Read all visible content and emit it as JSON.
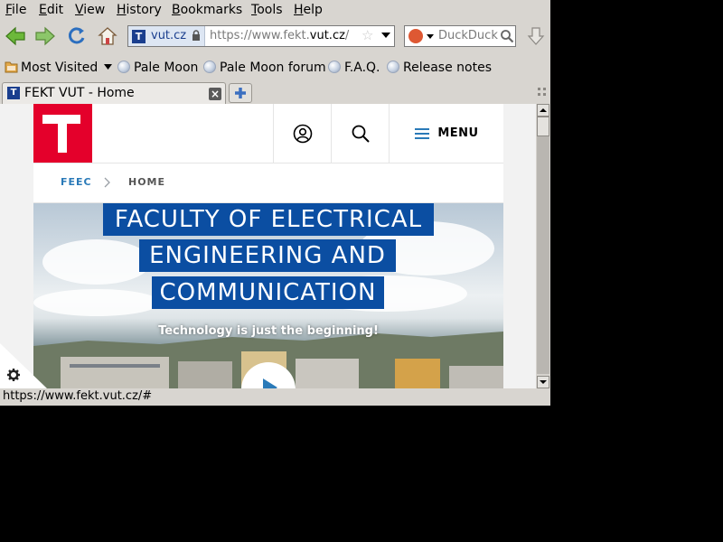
{
  "menubar": {
    "file": "ile",
    "file_key": "F",
    "edit": "dit",
    "edit_key": "E",
    "view": "iew",
    "view_key": "V",
    "history": "istory",
    "history_key": "H",
    "bookmarks": "ookmarks",
    "bookmarks_key": "B",
    "tools": "ools",
    "tools_key": "T",
    "help": "elp",
    "help_key": "H"
  },
  "navbar": {
    "identity_label": "vut.cz",
    "url_prefix": "https://www.fekt.",
    "url_domain": "vut.cz",
    "url_suffix": "/",
    "search_engine": "DuckDuckGo",
    "search_placeholder": "DuckDuck"
  },
  "bookmarks": [
    {
      "label": "Most Visited",
      "icon": "folder-icon"
    },
    {
      "label": "Pale Moon",
      "icon": "globe-icon"
    },
    {
      "label": "Pale Moon forum",
      "icon": "globe-icon"
    },
    {
      "label": "F.A.Q.",
      "icon": "globe-icon"
    },
    {
      "label": "Release notes",
      "icon": "globe-icon"
    }
  ],
  "tab": {
    "title": "FEKT VUT - Home",
    "favicon_letter": "T"
  },
  "site": {
    "menu_label": "MENU",
    "breadcrumb": [
      "FEEC",
      "HOME"
    ],
    "hero_lines": [
      "FACULTY OF ELECTRICAL",
      "ENGINEERING  AND",
      "COMMUNICATION"
    ],
    "tagline": "Technology is just the beginning!",
    "colors": {
      "brand_red": "#e4002b",
      "brand_blue": "#0b4ea2",
      "link_blue": "#2a7ab8"
    }
  },
  "status": {
    "text": "https://www.fekt.vut.cz/#"
  }
}
